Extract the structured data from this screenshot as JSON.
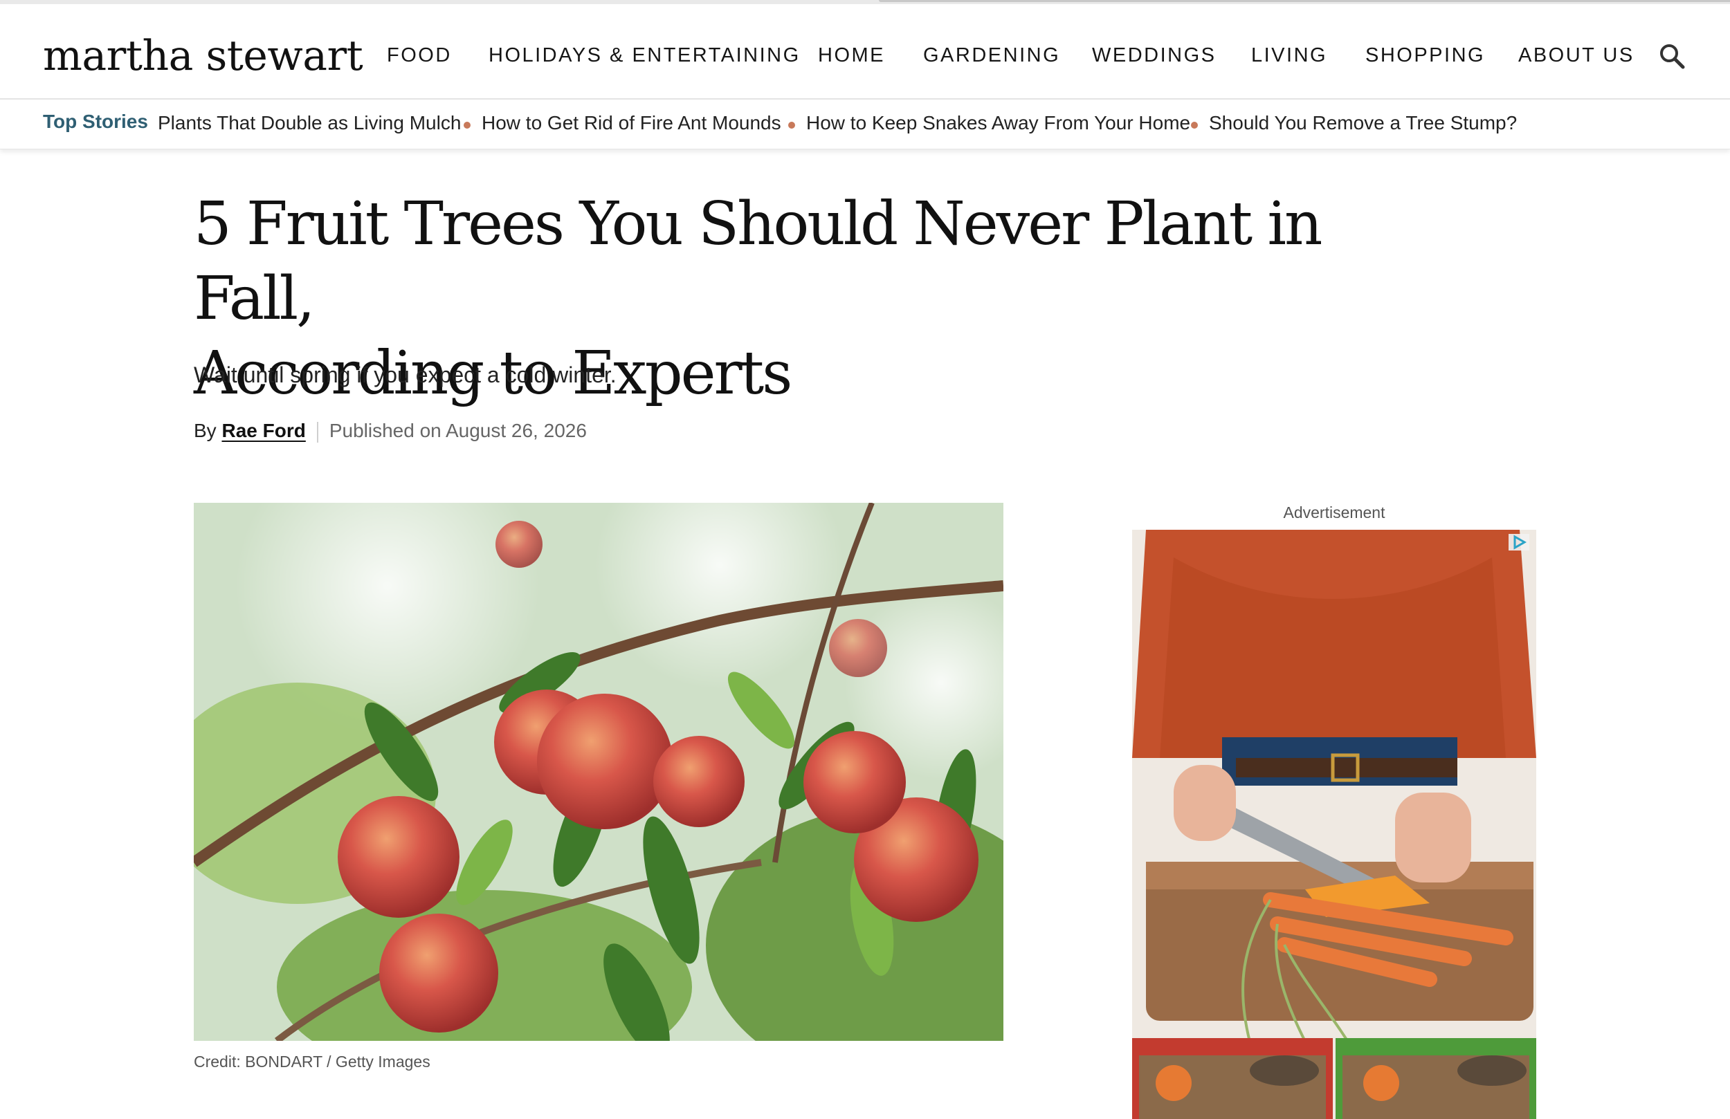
{
  "site": {
    "logo": "martha stewart"
  },
  "nav": {
    "items": [
      "FOOD",
      "HOLIDAYS & ENTERTAINING",
      "HOME",
      "GARDENING",
      "WEDDINGS",
      "LIVING",
      "SHOPPING",
      "ABOUT US"
    ],
    "search_icon": "search-icon"
  },
  "top_stories": {
    "label": "Top Stories",
    "links": [
      "Plants That Double as Living Mulch",
      "How to Get Rid of Fire Ant Mounds",
      "How to Keep Snakes Away From Your Home",
      "Should You Remove a Tree Stump?"
    ]
  },
  "article": {
    "title_line1": "5 Fruit Trees You Should Never Plant in Fall,",
    "title_line2": "According to Experts",
    "dek": "Wait until spring if you expect a cold winter.",
    "by": "By",
    "author": "Rae Ford",
    "published": "Published on August 26, 2026",
    "image_credit": "Credit: BONDART / Getty Images"
  },
  "ad": {
    "label": "Advertisement",
    "badge_icon": "adchoices-icon"
  },
  "colors": {
    "accent": "#2f5f73",
    "dot": "#c8795a",
    "text": "#111111"
  }
}
